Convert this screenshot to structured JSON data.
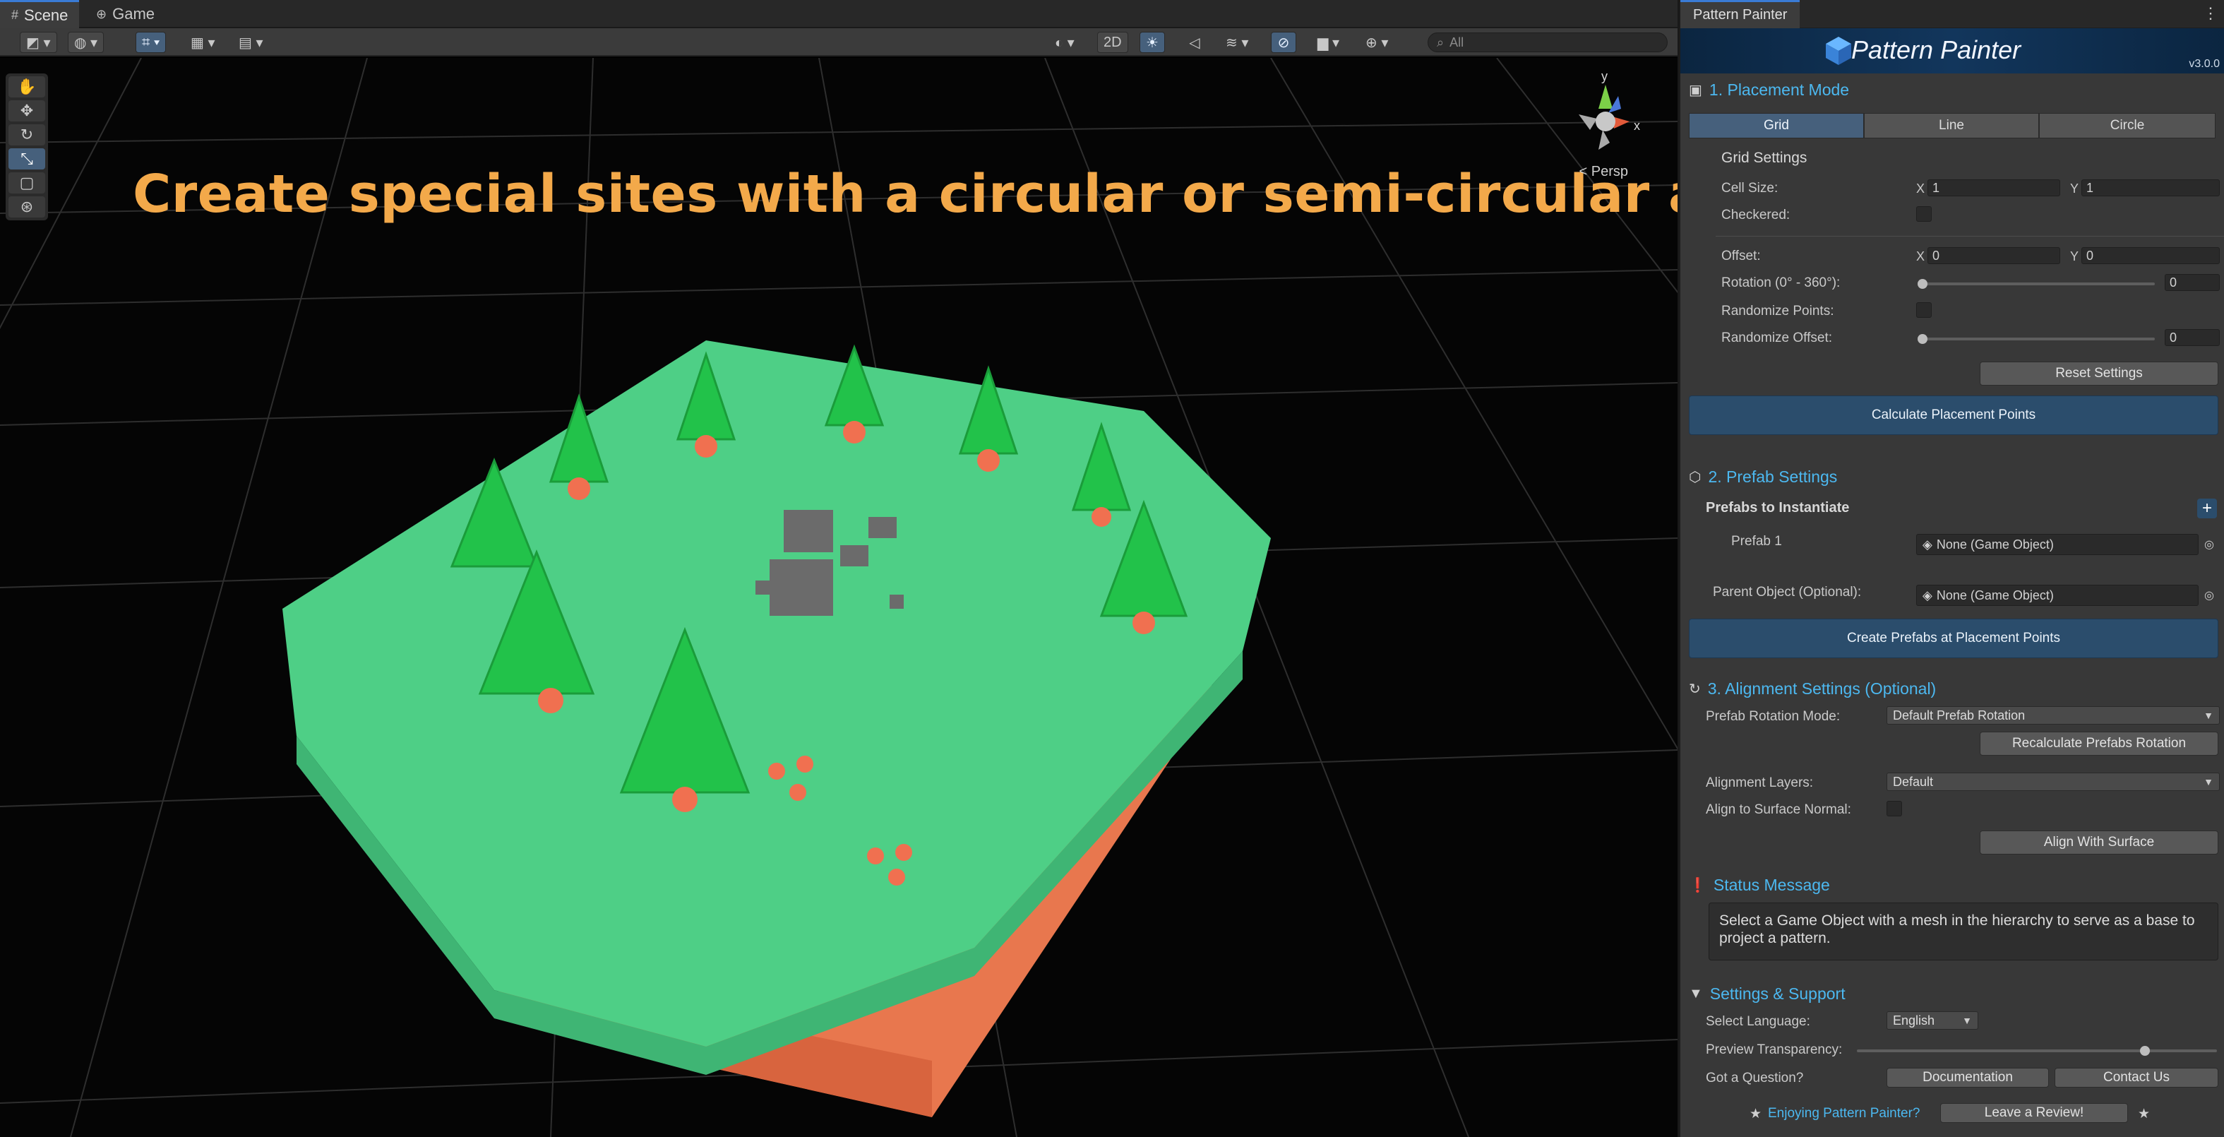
{
  "scene": {
    "tabs": [
      {
        "label": "Scene",
        "icon": "grid-icon"
      },
      {
        "label": "Game",
        "icon": "gamepad-icon"
      }
    ],
    "toolbar": {
      "mode_2d": "2D",
      "search_placeholder": "All"
    },
    "headline": "Create special sites with a circular or semi-circular arc",
    "gizmo": {
      "y": "y",
      "x": "x",
      "persp": "< Persp"
    }
  },
  "panel": {
    "tab_label": "Pattern Painter",
    "banner": {
      "title": "Pattern Painter",
      "version": "v3.0.0"
    },
    "placement": {
      "title": "1. Placement Mode",
      "modes": [
        "Grid",
        "Line",
        "Circle"
      ],
      "selected_mode": "Grid",
      "grid_settings_title": "Grid Settings",
      "cell_size_label": "Cell Size:",
      "cell_size_x": "1",
      "cell_size_y": "1",
      "checkered_label": "Checkered:",
      "offset_label": "Offset:",
      "offset_x": "0",
      "offset_y": "0",
      "rotation_label": "Rotation (0° - 360°):",
      "rotation_value": "0",
      "randomize_points_label": "Randomize Points:",
      "randomize_offset_label": "Randomize Offset:",
      "randomize_offset_value": "0",
      "reset_button": "Reset Settings",
      "calculate_button": "Calculate Placement Points",
      "axis_x": "X",
      "axis_y": "Y"
    },
    "prefab": {
      "title": "2. Prefab Settings",
      "prefabs_title": "Prefabs to Instantiate",
      "prefab1_label": "Prefab 1",
      "prefab1_value": "None (Game Object)",
      "parent_label": "Parent Object (Optional):",
      "parent_value": "None (Game Object)",
      "create_button": "Create Prefabs at Placement Points",
      "add_symbol": "+"
    },
    "alignment": {
      "title": "3. Alignment Settings (Optional)",
      "rotation_mode_label": "Prefab Rotation Mode:",
      "rotation_mode_value": "Default Prefab Rotation",
      "recalc_button": "Recalculate Prefabs Rotation",
      "layers_label": "Alignment Layers:",
      "layers_value": "Default",
      "surface_normal_label": "Align to Surface Normal:",
      "align_button": "Align With Surface"
    },
    "status": {
      "title": "Status Message",
      "message": "Select a Game Object with a mesh in the hierarchy to serve as a base to project a pattern."
    },
    "support": {
      "title": "Settings & Support",
      "language_label": "Select Language:",
      "language_value": "English",
      "transparency_label": "Preview Transparency:",
      "transparency_value": 0.8,
      "question_label": "Got a Question?",
      "docs_button": "Documentation",
      "contact_button": "Contact Us",
      "enjoying_text": "Enjoying Pattern Painter?",
      "review_button": "Leave a Review!"
    }
  },
  "colors": {
    "accent_blue": "#4cb8f0",
    "headline": "#f3a94a",
    "island_top": "#4ecf86",
    "island_side": "#e8774e",
    "tree": "#22c24a"
  }
}
